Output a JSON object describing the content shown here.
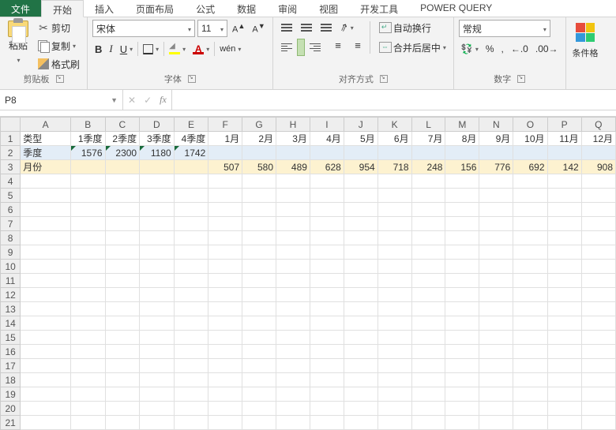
{
  "tabs": {
    "file": "文件",
    "home": "开始",
    "insert": "插入",
    "layout": "页面布局",
    "formulas": "公式",
    "data": "数据",
    "review": "审阅",
    "view": "视图",
    "developer": "开发工具",
    "powerquery": "POWER QUERY"
  },
  "clipboard": {
    "paste": "粘贴",
    "cut": "剪切",
    "copy": "复制",
    "format_painter": "格式刷",
    "group": "剪贴板"
  },
  "font": {
    "name": "宋体",
    "size": "11",
    "inc": "A",
    "dec": "A",
    "bold": "B",
    "italic": "I",
    "underline": "U",
    "wen": "wén",
    "fontcolor_letter": "A",
    "group": "字体"
  },
  "align": {
    "wrap": "自动换行",
    "merge": "合并后居中",
    "group": "对齐方式"
  },
  "number": {
    "format": "常规",
    "currency": "%",
    "comma": ",",
    "inc": ".0",
    "dec": ".00",
    "group": "数字"
  },
  "condfmt": "条件格",
  "namebox": "P8",
  "fx": "fx",
  "cancel": "✕",
  "enter": "✓",
  "sheet": {
    "cols": [
      "A",
      "B",
      "C",
      "D",
      "E",
      "F",
      "G",
      "H",
      "I",
      "J",
      "K",
      "L",
      "M",
      "N",
      "O",
      "P",
      "Q"
    ],
    "r1": [
      "类型",
      "1季度",
      "2季度",
      "3季度",
      "4季度",
      "1月",
      "2月",
      "3月",
      "4月",
      "5月",
      "6月",
      "7月",
      "8月",
      "9月",
      "10月",
      "11月",
      "12月"
    ],
    "r2": [
      "季度",
      "1576",
      "2300",
      "1180",
      "1742",
      "",
      "",
      "",
      "",
      "",
      "",
      "",
      "",
      "",
      "",
      "",
      ""
    ],
    "r3": [
      "月份",
      "",
      "",
      "",
      "",
      "507",
      "580",
      "489",
      "628",
      "954",
      "718",
      "248",
      "156",
      "776",
      "692",
      "142",
      "908"
    ]
  },
  "chart_data": {
    "type": "table",
    "title": "",
    "columns": [
      "类型",
      "1季度",
      "2季度",
      "3季度",
      "4季度",
      "1月",
      "2月",
      "3月",
      "4月",
      "5月",
      "6月",
      "7月",
      "8月",
      "9月",
      "10月",
      "11月",
      "12月"
    ],
    "rows": [
      {
        "类型": "季度",
        "1季度": 1576,
        "2季度": 2300,
        "3季度": 1180,
        "4季度": 1742
      },
      {
        "类型": "月份",
        "1月": 507,
        "2月": 580,
        "3月": 489,
        "4月": 628,
        "5月": 954,
        "6月": 718,
        "7月": 248,
        "8月": 156,
        "9月": 776,
        "10月": 692,
        "11月": 142,
        "12月": 908
      }
    ]
  }
}
